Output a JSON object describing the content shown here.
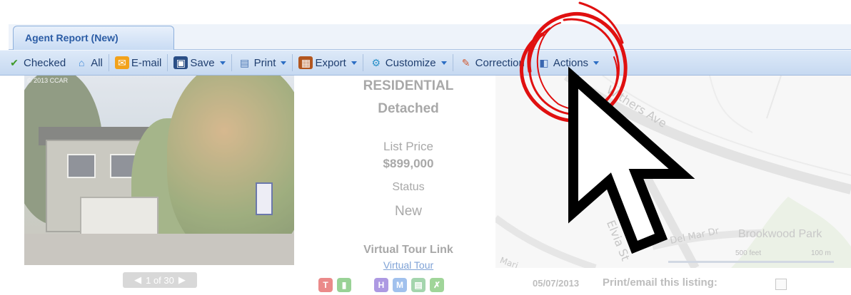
{
  "tab": {
    "label": "Agent Report (New)"
  },
  "toolbar": {
    "items": [
      {
        "label": "Checked",
        "icon": "checkmark-icon",
        "color": "#3f9a2a"
      },
      {
        "label": "All",
        "icon": "house-icon",
        "color": "#3a86d6"
      },
      {
        "label": "E-mail",
        "icon": "envelope-icon",
        "color": "#f2a21b"
      },
      {
        "label": "Save",
        "icon": "floppy-disk-icon",
        "color": "#2a4e86"
      },
      {
        "label": "Print",
        "icon": "printer-icon",
        "color": "#4b76b3"
      },
      {
        "label": "Export",
        "icon": "briefcase-icon",
        "color": "#b2561f"
      },
      {
        "label": "Customize",
        "icon": "gear-icon",
        "color": "#2a91c9"
      },
      {
        "label": "Correction",
        "icon": "pencil-icon",
        "color": "#d05a32"
      },
      {
        "label": "Actions",
        "icon": "actions-icon",
        "color": "#3a66b0"
      }
    ]
  },
  "photo": {
    "copyright": "© 2013 CCAR"
  },
  "pager": {
    "prev": "◀",
    "text": "1 of 30",
    "next": "▶"
  },
  "listing": {
    "type": "RESIDENTIAL",
    "subtype": "Detached",
    "list_price_label": "List Price",
    "list_price": "$899,000",
    "status_label": "Status",
    "status": "New",
    "virtual_tour_label": "Virtual Tour Link",
    "virtual_tour_link": "Virtual Tour"
  },
  "badges": [
    {
      "label": "T",
      "color": "#e35a5a"
    },
    {
      "label": "▮",
      "color": "#6fbf6a"
    },
    {
      "label": "H",
      "color": "#8b6fd6"
    },
    {
      "label": "M",
      "color": "#7aa8e6"
    },
    {
      "label": "▤",
      "color": "#7ec48b"
    },
    {
      "label": "✗",
      "color": "#78c46f"
    }
  ],
  "map": {
    "streets": [
      "Withers Ave",
      "Del Mar Dr",
      "Elvia St",
      "Mari"
    ],
    "park": "Brookwood Park",
    "scale_feet": "500 feet",
    "scale_m": "100 m"
  },
  "footer": {
    "date": "05/07/2013",
    "print_label": "Print/email this listing:"
  },
  "annotation": {
    "circle_color": "#e01010"
  }
}
